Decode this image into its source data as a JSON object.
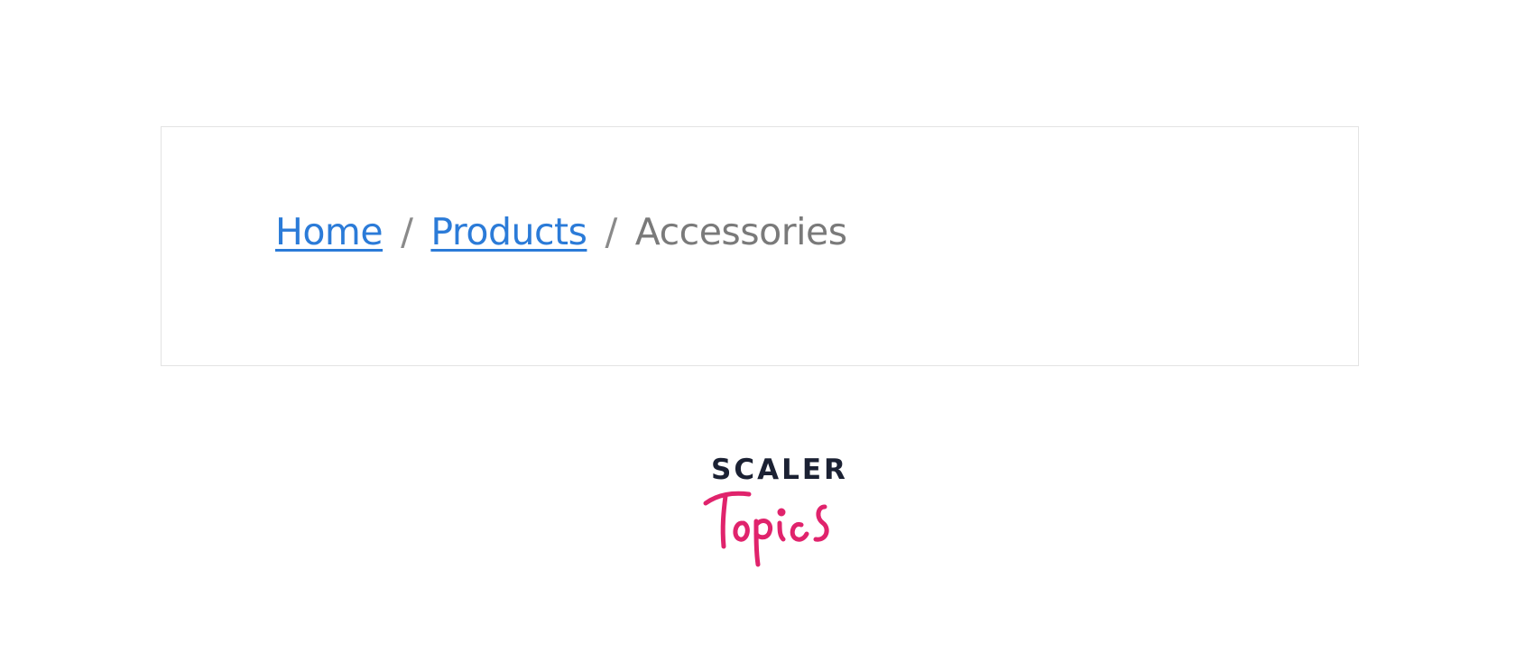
{
  "breadcrumb": {
    "items": [
      {
        "label": "Home",
        "type": "link"
      },
      {
        "label": "Products",
        "type": "link"
      },
      {
        "label": "Accessories",
        "type": "current"
      }
    ],
    "separator": "/"
  },
  "brand": {
    "name_top": "SCALER",
    "name_script": "Topics",
    "colors": {
      "top": "#1b2133",
      "script": "#e0236c"
    }
  },
  "colors": {
    "link": "#2b7bd8",
    "separator": "#8a8a8a",
    "current": "#7a7a7a",
    "frame_border": "#e3e3e3"
  }
}
